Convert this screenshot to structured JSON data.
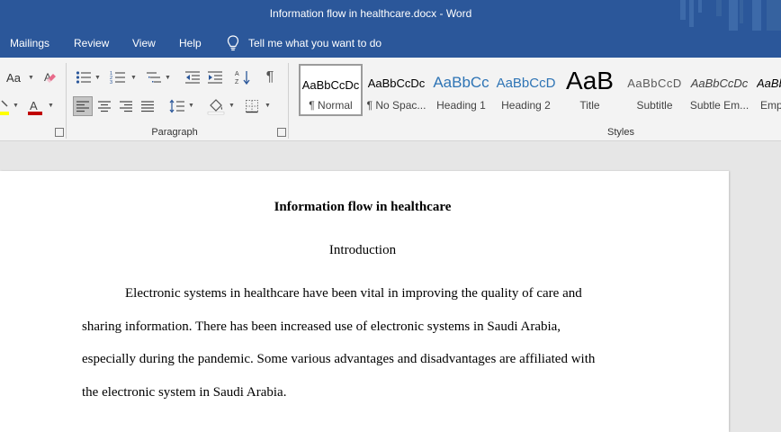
{
  "window": {
    "title": "Information flow in healthcare.docx  -  Word"
  },
  "tabs": [
    {
      "label": "Mailings"
    },
    {
      "label": "Review"
    },
    {
      "label": "View"
    },
    {
      "label": "Help"
    }
  ],
  "tell_me": {
    "label": "Tell me what you want to do"
  },
  "font_group": {
    "change_case_label": "Aa"
  },
  "paragraph_group": {
    "label": "Paragraph"
  },
  "styles_group": {
    "label": "Styles",
    "items": [
      {
        "sample": "AaBbCcDc",
        "label": "¶ Normal",
        "selected": true
      },
      {
        "sample": "AaBbCcDc",
        "label": "¶ No Spac..."
      },
      {
        "sample": "AaBbCc",
        "label": "Heading 1"
      },
      {
        "sample": "AaBbCcD",
        "label": "Heading 2"
      },
      {
        "sample": "AaB",
        "label": "Title"
      },
      {
        "sample": "AaBbCcD",
        "label": "Subtitle"
      },
      {
        "sample": "AaBbCcDc",
        "label": "Subtle Em..."
      },
      {
        "sample": "AaBbCcDc",
        "label": "Emp"
      }
    ]
  },
  "colors": {
    "titlebar": "#2b579a",
    "highlight": "#ffff00",
    "font_color": "#c00000"
  },
  "document": {
    "title": "Information flow in healthcare",
    "heading": "Introduction",
    "paragraph_lines": [
      "Electronic systems in healthcare have been vital in improving the quality of care and",
      "sharing information. There has been increased use of electronic systems in Saudi Arabia,",
      "especially during the pandemic. Some various advantages and disadvantages are affiliated with",
      "the electronic system in Saudi Arabia."
    ]
  }
}
